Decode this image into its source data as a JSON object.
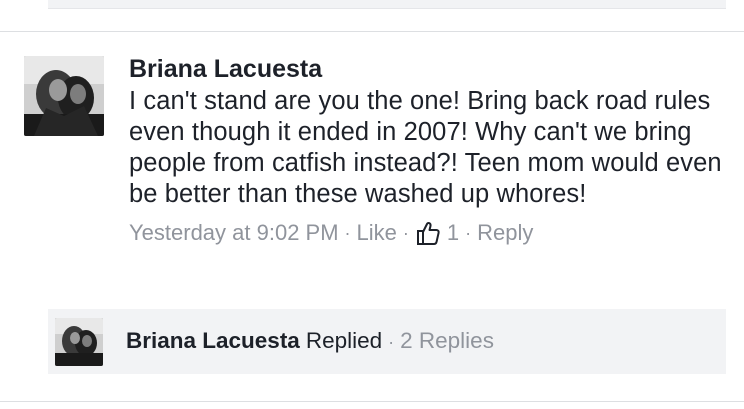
{
  "comment": {
    "author": "Briana Lacuesta",
    "text": "I can't stand are you the one! Bring back road rules even though it ended in 2007! Why can't we bring people from catfish instead?! Teen mom would even be better than these washed up whores!",
    "timestamp": "Yesterday at 9:02 PM",
    "separator": "·",
    "like_label": "Like",
    "like_icon": "thumbs-up-icon",
    "like_count": "1",
    "reply_label": "Reply"
  },
  "reply_summary": {
    "author": "Briana Lacuesta",
    "verb": "Replied",
    "separator": "·",
    "count_label": "2 Replies"
  },
  "colors": {
    "text_primary": "#1d2129",
    "text_secondary": "#90949c",
    "reply_bg": "#f2f3f5",
    "divider": "#dddfe2"
  }
}
